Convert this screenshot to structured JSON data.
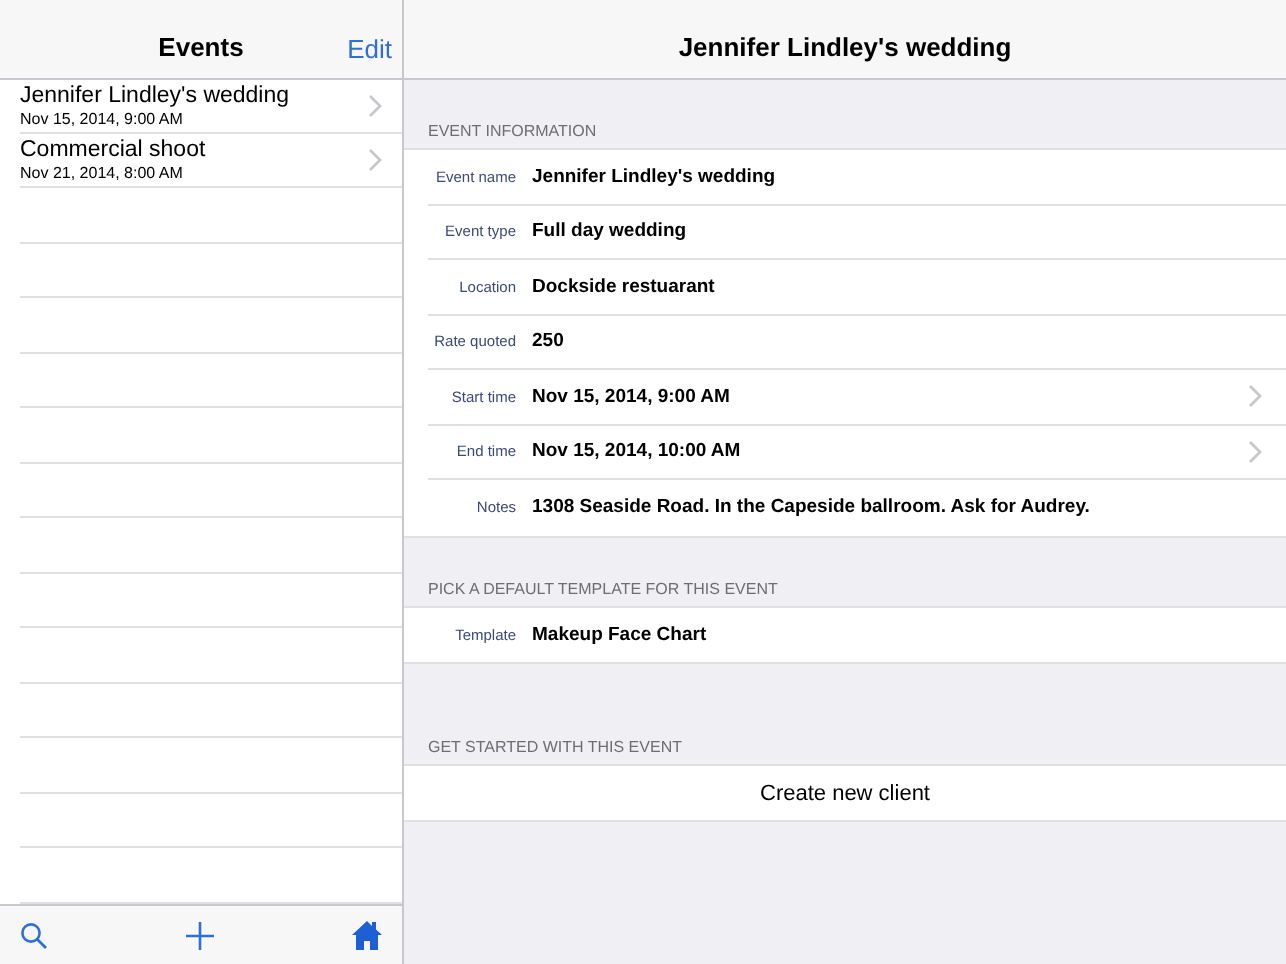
{
  "master": {
    "title": "Events",
    "edit_button": "Edit",
    "events": [
      {
        "title": "Jennifer Lindley's wedding",
        "date": "Nov 15, 2014, 9:00 AM"
      },
      {
        "title": "Commercial shoot",
        "date": "Nov 21, 2014, 8:00 AM"
      }
    ]
  },
  "detail": {
    "title": "Jennifer Lindley's wedding",
    "sections": [
      {
        "header": "EVENT INFORMATION",
        "kind": "fields",
        "rows": [
          {
            "label": "Event name",
            "value": "Jennifer Lindley's wedding",
            "disclosure": false
          },
          {
            "label": "Event type",
            "value": "Full day wedding",
            "disclosure": false
          },
          {
            "label": "Location",
            "value": "Dockside restuarant",
            "disclosure": false
          },
          {
            "label": "Rate quoted",
            "value": "250",
            "disclosure": false
          },
          {
            "label": "Start time",
            "value": "Nov 15, 2014, 9:00 AM",
            "disclosure": true
          },
          {
            "label": "End time",
            "value": "Nov 15, 2014, 10:00 AM",
            "disclosure": true
          },
          {
            "label": "Notes",
            "value": "1308 Seaside Road. In the Capeside ballroom. Ask for Audrey.",
            "disclosure": false
          }
        ]
      },
      {
        "header": "PICK A DEFAULT TEMPLATE FOR THIS EVENT",
        "kind": "fields",
        "rows": [
          {
            "label": "Template",
            "value": "Makeup Face Chart",
            "disclosure": false
          }
        ]
      },
      {
        "header": "GET STARTED WITH THIS EVENT",
        "kind": "action",
        "label": "Create new client"
      }
    ]
  }
}
